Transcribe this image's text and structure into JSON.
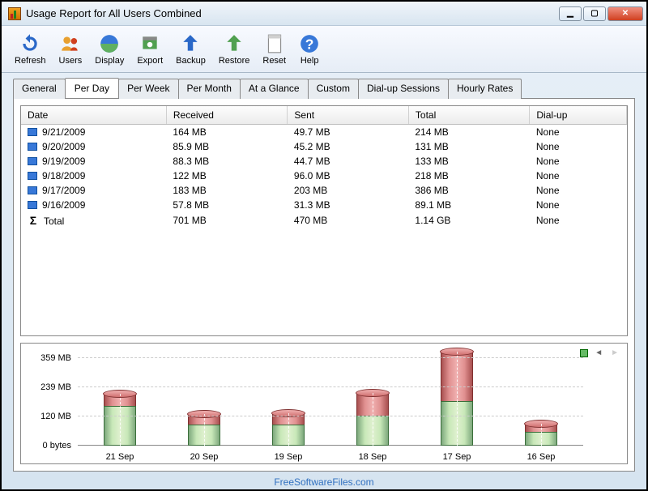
{
  "window": {
    "title": "Usage Report for All Users Combined"
  },
  "toolbar": {
    "refresh": "Refresh",
    "users": "Users",
    "display": "Display",
    "export": "Export",
    "backup": "Backup",
    "restore": "Restore",
    "reset": "Reset",
    "help": "Help"
  },
  "tabs": {
    "general": "General",
    "per_day": "Per Day",
    "per_week": "Per Week",
    "per_month": "Per Month",
    "at_a_glance": "At a Glance",
    "custom": "Custom",
    "dial_up_sessions": "Dial-up Sessions",
    "hourly_rates": "Hourly Rates",
    "active": "per_day"
  },
  "table": {
    "columns": {
      "date": "Date",
      "received": "Received",
      "sent": "Sent",
      "total": "Total",
      "dial_up": "Dial-up"
    },
    "rows": [
      {
        "date": "9/21/2009",
        "received": "164 MB",
        "sent": "49.7 MB",
        "total": "214 MB",
        "dial_up": "None"
      },
      {
        "date": "9/20/2009",
        "received": "85.9 MB",
        "sent": "45.2 MB",
        "total": "131 MB",
        "dial_up": "None"
      },
      {
        "date": "9/19/2009",
        "received": "88.3 MB",
        "sent": "44.7 MB",
        "total": "133 MB",
        "dial_up": "None"
      },
      {
        "date": "9/18/2009",
        "received": "122 MB",
        "sent": "96.0 MB",
        "total": "218 MB",
        "dial_up": "None"
      },
      {
        "date": "9/17/2009",
        "received": "183 MB",
        "sent": "203 MB",
        "total": "386 MB",
        "dial_up": "None"
      },
      {
        "date": "9/16/2009",
        "received": "57.8 MB",
        "sent": "31.3 MB",
        "total": "89.1 MB",
        "dial_up": "None"
      }
    ],
    "total_row": {
      "label": "Total",
      "received": "701 MB",
      "sent": "470 MB",
      "total": "1.14 GB",
      "dial_up": "None"
    }
  },
  "chart_data": {
    "type": "bar",
    "stacked": true,
    "categories": [
      "21 Sep",
      "20 Sep",
      "19 Sep",
      "18 Sep",
      "17 Sep",
      "16 Sep"
    ],
    "series": [
      {
        "name": "Received",
        "color": "#8cc080",
        "values": [
          164,
          85.9,
          88.3,
          122,
          183,
          57.8
        ]
      },
      {
        "name": "Sent",
        "color": "#c05050",
        "values": [
          49.7,
          45.2,
          44.7,
          96.0,
          203,
          31.3
        ]
      }
    ],
    "y_ticks": [
      0,
      120,
      239,
      359
    ],
    "y_tick_labels": [
      "0 bytes",
      "120 MB",
      "239 MB",
      "359 MB"
    ],
    "ylim": [
      0,
      400
    ],
    "ylabel": "",
    "xlabel": "",
    "title": ""
  },
  "footer": {
    "watermark": "FreeSoftwareFiles.com"
  }
}
